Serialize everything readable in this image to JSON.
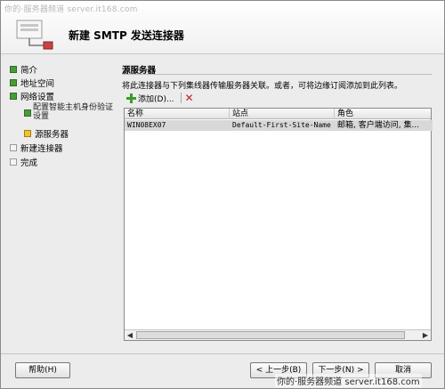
{
  "watermark_top": "你的·服务器频道 server.it168.com",
  "watermark_bottom": "你的·服务器频道 server.it168.com",
  "wizard_title": "新建 SMTP 发送连接器",
  "nav": {
    "items": [
      {
        "label": "简介",
        "state": "done"
      },
      {
        "label": "地址空间",
        "state": "done"
      },
      {
        "label": "网络设置",
        "state": "done"
      },
      {
        "label": "配置智能主机身份验证设置",
        "state": "done"
      },
      {
        "label": "源服务器",
        "state": "current"
      },
      {
        "label": "新建连接器",
        "state": "pending"
      },
      {
        "label": "完成",
        "state": "pending"
      }
    ]
  },
  "main": {
    "section_title": "源服务器",
    "description": "将此连接器与下列集线器传输服务器关联。或者，可将边缘订阅添加到此列表。",
    "add_label": "添加(D)...",
    "columns": [
      "名称",
      "站点",
      "角色"
    ],
    "rows": [
      {
        "name": "WIN08EX07",
        "site": "Default-First-Site-Name",
        "roles": "邮箱, 客户端访问, 集..."
      }
    ]
  },
  "buttons": {
    "help": "帮助(H)",
    "back": "< 上一步(B)",
    "next": "下一步(N) >",
    "cancel": "取消"
  },
  "colors": {
    "done": "#4a9a3a",
    "current": "#f1c232",
    "remove": "#c32121"
  }
}
